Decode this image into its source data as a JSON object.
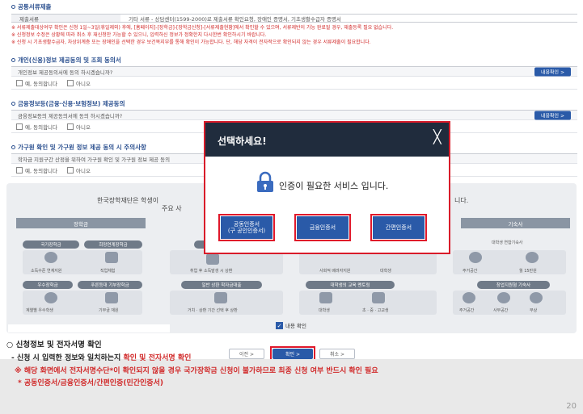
{
  "doc_submit": {
    "section_title": "공통서류제출",
    "row_label": "제출서류",
    "row_value": "기타 서류 - 상담센터(1599-2000)로 제출서류 확인요청, 장애인 증명서, 기초생활수급자 증명서",
    "notices": [
      "※ 서류제출대상여부 확인은 신청 1일~3일(휴일제외) 후에, [홈페이지]-[장학금]-[장학금신청]-[서류제출현황]에서 확인할 수 있으며, 서류제반이 가능 완료될 경우, 재출등록 필요 없습니다.",
      "※ 신청정보 수정은 상황에 따라 취소 후 재신청만 가능할 수 있으니, 입력하신 정보가 정확한지 다시한번 확인하시기 바랍니다.",
      "※ 신청 시 기초생활수급자, 차상위계층 또는 장애인을 선택한 경우 보건복지부를 통해 확인이 가능합니다. 단, 해당 자격이 전자적으로 확인되지 않는 경우 서류제출이 필요합니다."
    ]
  },
  "privacy": {
    "section_title": "개인(신용)정보 제공동의 및 조회 동의서",
    "question": "개인정보 제공동의서에 동의 하시겠습니까?",
    "confirm_label": "내용확인 >",
    "yes_label": "예, 동의합니다",
    "no_label": "아니오"
  },
  "finance": {
    "section_title": "금융정보등(금융·신용·보험정보) 제공동의",
    "question": "금융정보등의 제공동의서에 동의 하시겠습니까?",
    "confirm_label": "내용확인 >",
    "yes_label": "예, 동의합니다",
    "no_label": "아니오"
  },
  "household": {
    "section_title": "가구원 확인 및 가구원 정보 제공 동의 시 주의사항",
    "question": "학자금 지원구간 산정을 위하여 가구원 확인 및 가구원 정보 제공 동의",
    "yes_label": "예, 동의합니다",
    "no_label": "아니오"
  },
  "panel": {
    "title_left": "한국장학재단은 학생이",
    "title_right": "니다.",
    "subtitle": "주요 사",
    "col1": "장학금",
    "col4": "기숙사",
    "pills": [
      "국가장학금",
      "희망연계장학금",
      "우수장학금",
      "푸른등대 기부장학금",
      "일반 상환 학자금대출",
      "대학생의 교육 멘토링",
      "창업지원형 기숙사"
    ],
    "small_labels": [
      "소득수준 연계지원",
      "직업체험",
      "취업 후 소득발생 시 상환",
      "사회적 배려자지원",
      "대학생",
      "주거공간",
      "월 15만원",
      "계열별 우수학생",
      "기부금 재원",
      "거치 · 상환 기간 선택 후 상환",
      "대학생",
      "초 · 중 · 고교생",
      "주거공간",
      "사무공간",
      "무상",
      "대학생 연합기숙사"
    ],
    "agree_label": "내용 확인"
  },
  "nav": {
    "prev": "이전  >",
    "confirm": "확인  >",
    "cancel": "취소  >"
  },
  "modal": {
    "title": "선택하세요!",
    "close": "╳",
    "message": "인증이 필요한 서비스 입니다.",
    "btn_cert_line1": "공동인증서",
    "btn_cert_line2": "(구 공인인증서)",
    "btn_finance": "금융인증서",
    "btn_simple": "간편인증서"
  },
  "description": {
    "heading": "○ 신청정보 및 전자서명 확인",
    "line1_prefix": " - 신청 시 입력한 정보와 일치하는지 ",
    "line1_highlight": "확인 및 전자서명 확인",
    "line2": "※ 해당 화면에서 전자서명수단*이 확인되지 않을 경우 국가장학금 신청이 불가하므로 최종 신청 여부 반드시 확인 필요",
    "line3": "* 공동인증서/금융인증서/간편인증(민간인증서)",
    "page_number": "20"
  },
  "colors": {
    "accent_blue": "#2a5aa8",
    "alert_red": "#d12a2a",
    "modal_header": "#202c3d"
  }
}
